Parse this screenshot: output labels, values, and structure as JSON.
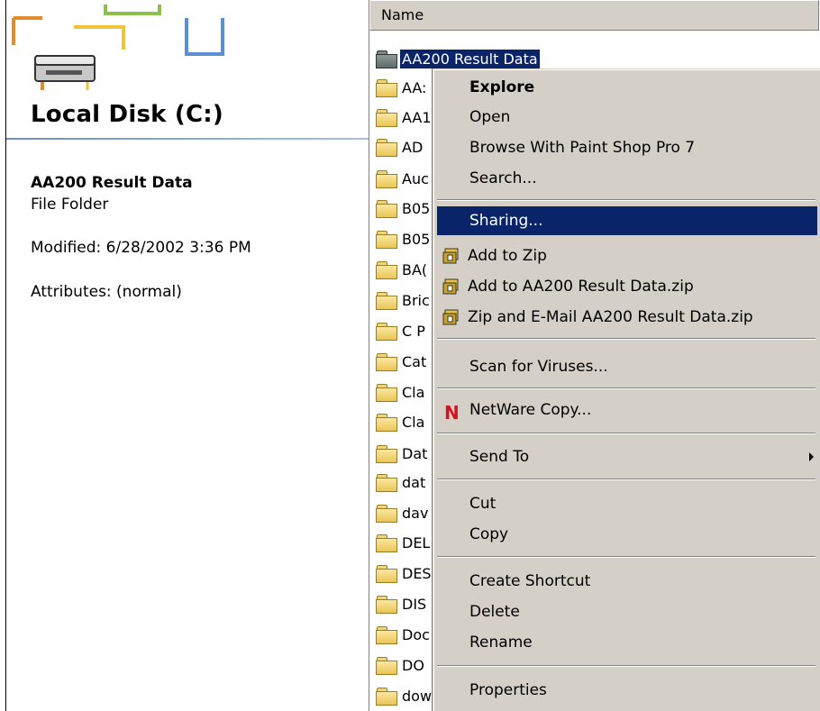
{
  "details": {
    "drive_title": "Local Disk (C:)",
    "item_name": "AA200 Result Data",
    "item_type": "File Folder",
    "modified": "Modified: 6/28/2002 3:36 PM",
    "attributes": "Attributes: (normal)"
  },
  "list": {
    "column_name": "Name",
    "files": [
      {
        "label": "AA200 Result Data",
        "selected": true
      },
      {
        "label": "AA:"
      },
      {
        "label": "AA1"
      },
      {
        "label": "AD"
      },
      {
        "label": "Auc"
      },
      {
        "label": "B05"
      },
      {
        "label": "B05"
      },
      {
        "label": "BA("
      },
      {
        "label": "Bric"
      },
      {
        "label": "C P"
      },
      {
        "label": "Cat"
      },
      {
        "label": "Cla"
      },
      {
        "label": "Cla"
      },
      {
        "label": "Dat"
      },
      {
        "label": "dat"
      },
      {
        "label": "dav"
      },
      {
        "label": "DEL"
      },
      {
        "label": "DES"
      },
      {
        "label": "DIS"
      },
      {
        "label": "Doc"
      },
      {
        "label": "DO"
      },
      {
        "label": "dow"
      }
    ]
  },
  "menu": {
    "explore": "Explore",
    "open": "Open",
    "browse_psp": "Browse With Paint Shop Pro 7",
    "search": "Search...",
    "sharing": "Sharing...",
    "add_zip": "Add to Zip",
    "add_named_zip": "Add to AA200 Result Data.zip",
    "zip_email": "Zip and E-Mail AA200 Result Data.zip",
    "scan": "Scan for Viruses...",
    "netware": "NetWare Copy...",
    "send_to": "Send To",
    "cut": "Cut",
    "copy": "Copy",
    "create_shortcut": "Create Shortcut",
    "delete": "Delete",
    "rename": "Rename",
    "properties": "Properties"
  },
  "icons": {
    "drive": "hard-drive-icon",
    "folder": "folder-icon",
    "zip": "winzip-icon",
    "netware": "netware-n-icon"
  },
  "colors": {
    "selection": "#0a246a",
    "menu_bg": "#d4d0c8",
    "netware_red": "#d6121e"
  }
}
